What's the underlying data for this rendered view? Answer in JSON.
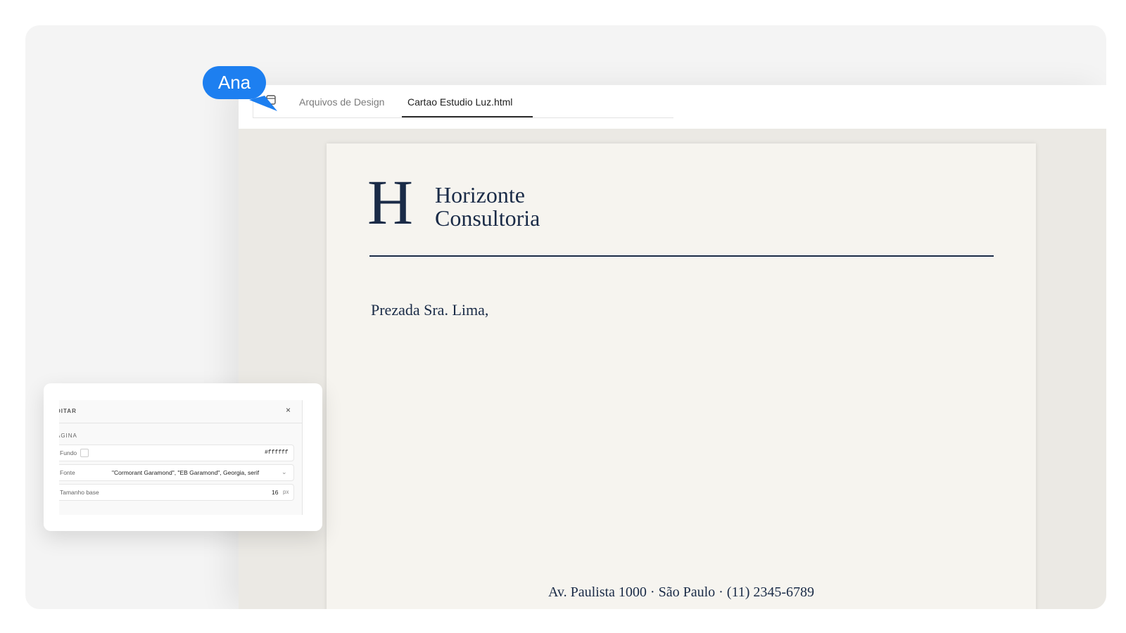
{
  "tabs": [
    {
      "label": "Arquivos de Design",
      "active": false
    },
    {
      "label": "Cartao Estudio Luz.html",
      "active": true
    }
  ],
  "cursor": {
    "user": "Ana",
    "color": "#1d7ff0"
  },
  "document": {
    "logo_letter": "H",
    "brand_line1": "Horizonte",
    "brand_line2": "Consultoria",
    "salutation": "Prezada Sra. Lima,",
    "footer_address": "Av. Paulista 1000 · São Paulo · (11) 2345-6789",
    "brand_color": "#1a2b47",
    "paper_color": "#f6f4ef"
  },
  "panel": {
    "title": "DITAR",
    "close": "×",
    "section": "ÁGINA",
    "fields": {
      "background": {
        "label": "Fundo",
        "value": "#ffffff"
      },
      "font": {
        "label": "Fonte",
        "value": "\"Cormorant Garamond\", \"EB Garamond\", Georgia, serif"
      },
      "base_size": {
        "label": "Tamanho base",
        "value": "16",
        "unit": "px"
      }
    }
  }
}
